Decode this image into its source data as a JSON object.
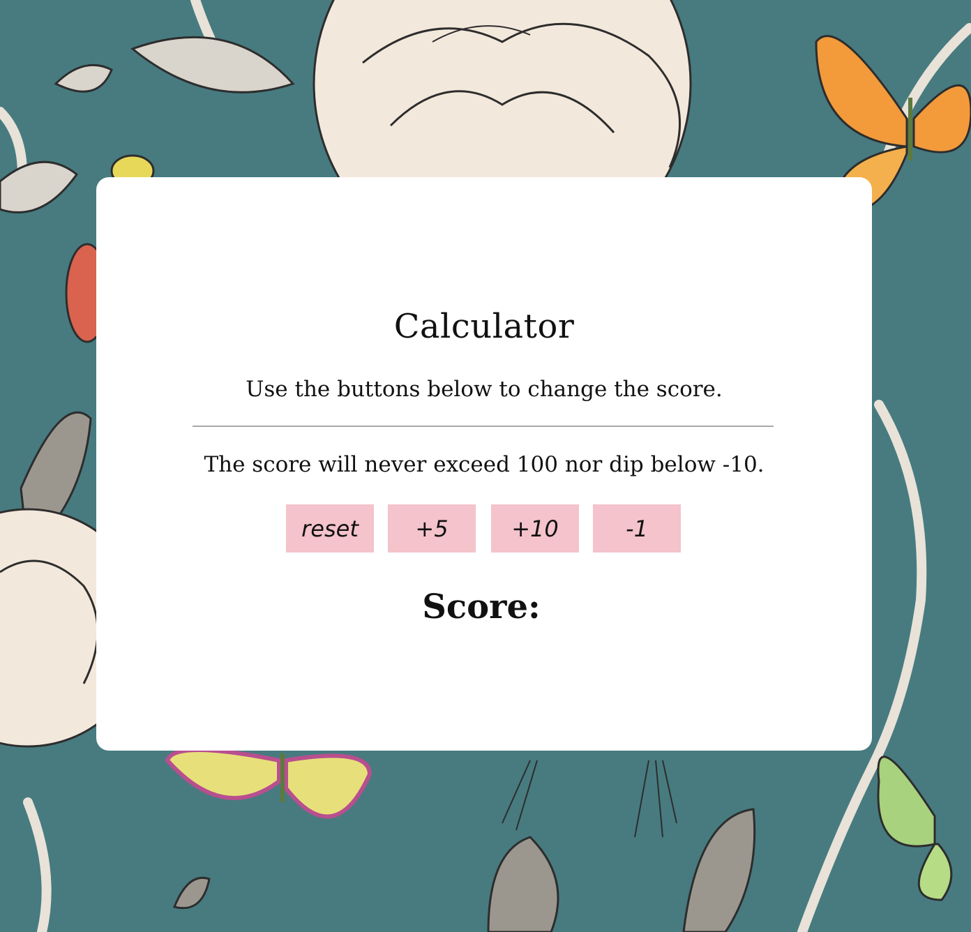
{
  "app": {
    "title": "Calculator",
    "instructions": "Use the buttons below to change the score.",
    "limits_note": "The score will never exceed 100 nor dip below -10."
  },
  "buttons": {
    "reset": "reset",
    "plus5": "+5",
    "plus10": "+10",
    "minus1": "-1"
  },
  "score": {
    "label": "Score:",
    "value": ""
  },
  "colors": {
    "background": "#477b80",
    "card": "#ffffff",
    "button": "#f4c3cb"
  }
}
